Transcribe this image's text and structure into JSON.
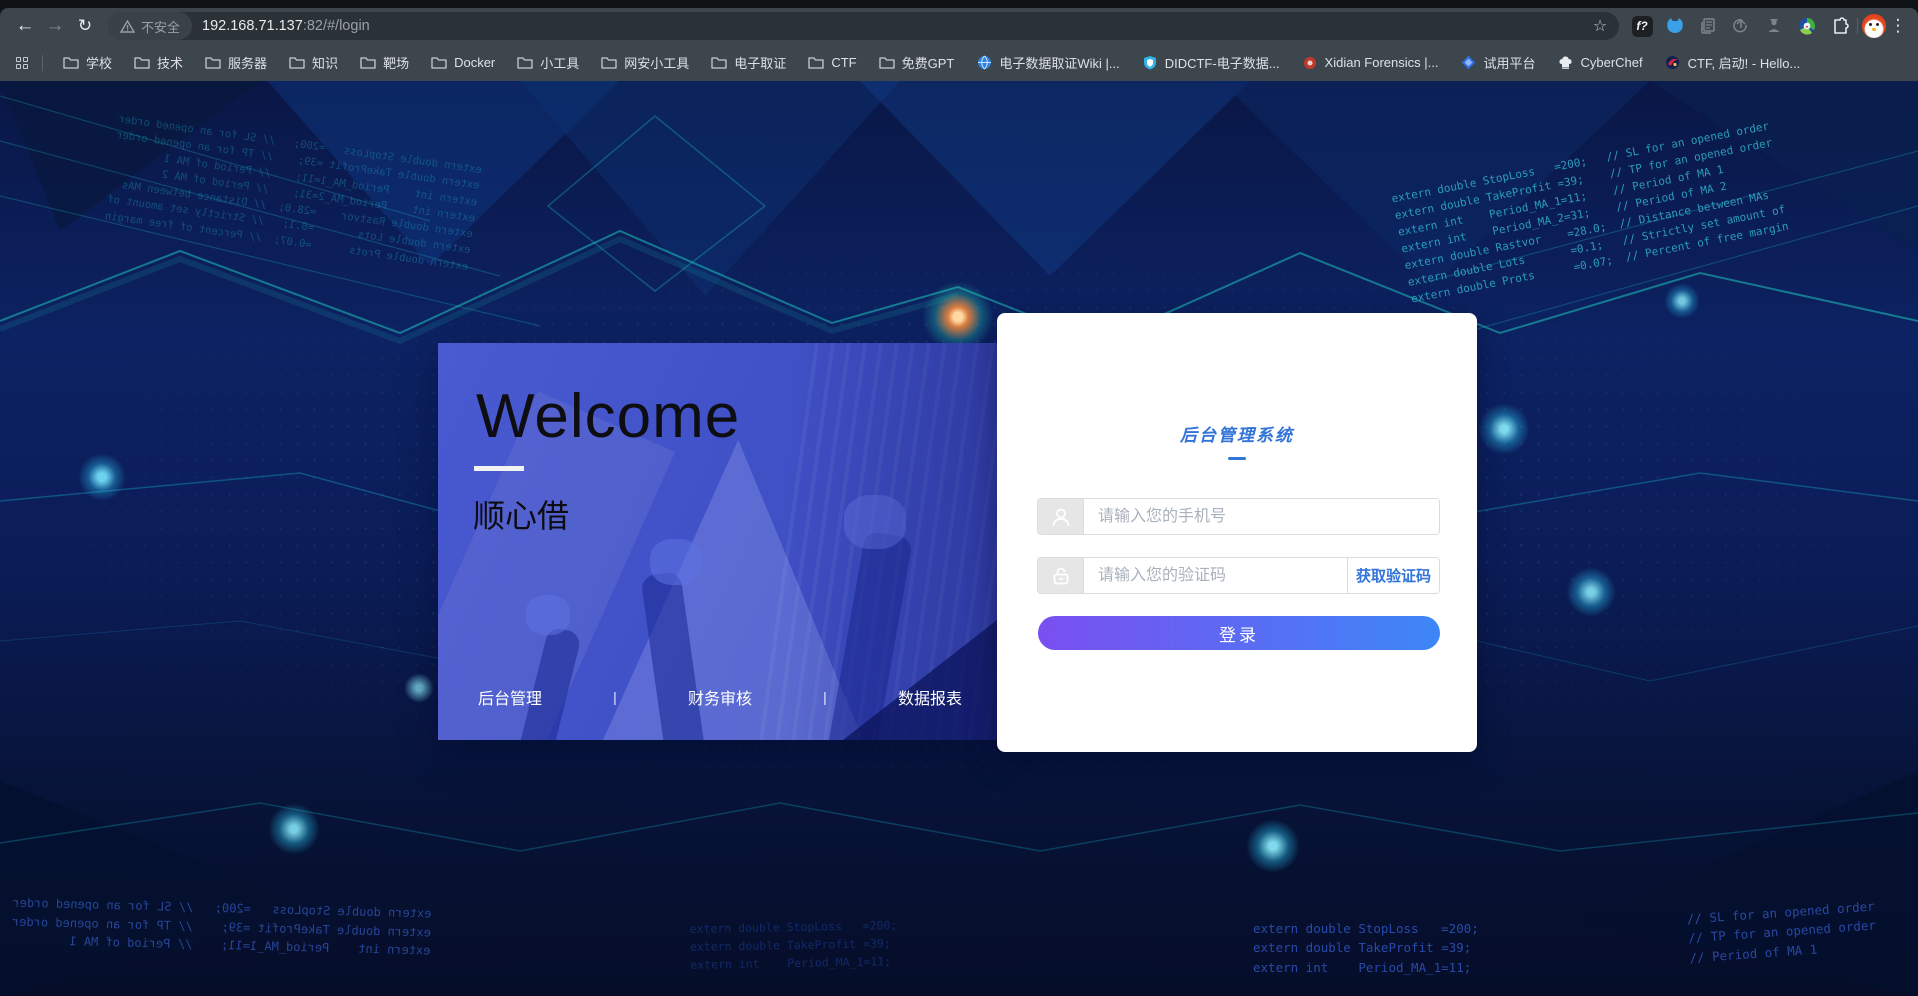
{
  "browser": {
    "toolbar": {
      "security_label": "不安全",
      "url_host": "192.168.71.137",
      "url_path": ":82/#/login",
      "fn_badge_label": "f?"
    },
    "icons": {
      "back": "←",
      "forward": "→",
      "reload": "↻",
      "star": "☆",
      "menu": "⋮"
    },
    "bookmarks": [
      {
        "label": "学校",
        "icon": "folder"
      },
      {
        "label": "技术",
        "icon": "folder"
      },
      {
        "label": "服务器",
        "icon": "folder"
      },
      {
        "label": "知识",
        "icon": "folder"
      },
      {
        "label": "靶场",
        "icon": "folder"
      },
      {
        "label": "Docker",
        "icon": "folder"
      },
      {
        "label": "小工具",
        "icon": "folder"
      },
      {
        "label": "网安小工具",
        "icon": "folder"
      },
      {
        "label": "电子取证",
        "icon": "folder"
      },
      {
        "label": "CTF",
        "icon": "folder"
      },
      {
        "label": "免费GPT",
        "icon": "folder"
      },
      {
        "label": "电子数据取证Wiki |...",
        "icon": "globe"
      },
      {
        "label": "DIDCTF-电子数据...",
        "icon": "shield"
      },
      {
        "label": "Xidian Forensics |...",
        "icon": "red-dot"
      },
      {
        "label": "试用平台",
        "icon": "diamond"
      },
      {
        "label": "CyberChef",
        "icon": "chef-hat"
      },
      {
        "label": "CTF, 启动! - Hello...",
        "icon": "swirl"
      }
    ]
  },
  "welcome_panel": {
    "title": "Welcome",
    "brand": "顺心借",
    "links": [
      "后台管理",
      "财务审核",
      "数据报表"
    ],
    "divider": "|"
  },
  "login_card": {
    "title": "后台管理系统",
    "phone_placeholder": "请输入您的手机号",
    "code_placeholder": "请输入您的验证码",
    "get_code_label": "获取验证码",
    "login_label": "登录"
  },
  "background_code": {
    "mql": "extern double StopLoss   =200;   // SL for an opened order\nextern double TakeProfit =39;    // TP for an opened order\nextern int    Period_MA_1=11;    // Period of MA 1\nextern int    Period_MA_2=31;    // Period of MA 2\nextern double Rastvor    =28.0;  // Distance between MAs\nextern double Lots       =0.1;   // Strictly set amount of\nextern double Prots      =0.07;  // Percent of free margin",
    "mql_short": "extern double StopLoss   =200;   // SL for an opened order\nextern double TakeProfit =39;    // TP for an opened order\nextern int    Period_MA_1=11;    // Period of MA 1",
    "extern_short": "extern double StopLoss   =200;\nextern double TakeProfit =39;\nextern int    Period_MA_1=11;",
    "comments_short": "// SL for an opened order\n// TP for an opened order\n// Period of MA 1"
  },
  "colors": {
    "toolbar_bg": "#3e464d",
    "omnibox_bg": "#2b3237",
    "page_bg_navy": "#0a1746",
    "panel_blue": "#4152c8",
    "accent_blue": "#3273d8",
    "button_gradient_start": "#7a4ff0",
    "button_gradient_end": "#3d87f7",
    "teal_line": "#1ed3c4",
    "flare_orange": "#ff8c3a"
  }
}
